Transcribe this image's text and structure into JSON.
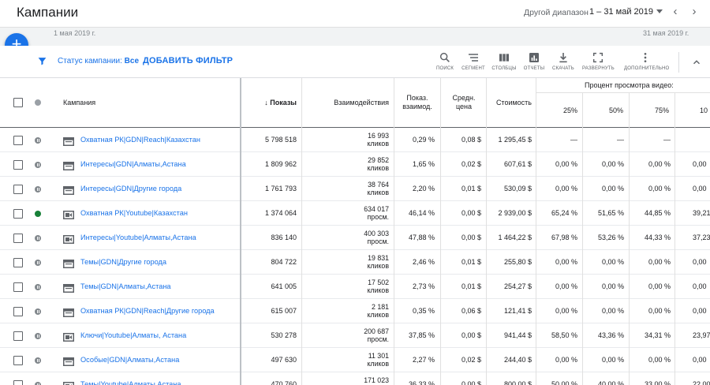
{
  "header": {
    "title": "Кампании",
    "range_label": "Другой диапазон",
    "range_value": "1 – 31 май 2019"
  },
  "strip": {
    "date_left": "1 мая 2019 г.",
    "date_right": "31 мая 2019 г."
  },
  "fab": {
    "label": "+"
  },
  "filter": {
    "status_prefix": "Статус кампании:",
    "status_value": "Все",
    "add_filter": "ДОБАВИТЬ ФИЛЬТР"
  },
  "tools": [
    {
      "label": "ПОИСК",
      "icon": "search-icon"
    },
    {
      "label": "СЕГМЕНТ",
      "icon": "segment-icon"
    },
    {
      "label": "СТОЛБЦЫ",
      "icon": "columns-icon"
    },
    {
      "label": "ОТЧЕТЫ",
      "icon": "reports-icon"
    },
    {
      "label": "СКАЧАТЬ",
      "icon": "download-icon"
    },
    {
      "label": "РАЗВЕРНУТЬ",
      "icon": "fullscreen-icon"
    },
    {
      "label": "ДОПОЛНИТЕЛЬНО",
      "icon": "more-vert-icon"
    }
  ],
  "columns": {
    "campaign": "Кампания",
    "impressions": "Показы",
    "interactions": "Взаимодействия",
    "interaction_rate": "Показ. взаимод.",
    "avg_cost": "Средн. цена",
    "cost": "Стоимость",
    "video_group": "Процент просмотра видео:",
    "p25": "25%",
    "p50": "50%",
    "p75": "75%",
    "p100": "10"
  },
  "rows": [
    {
      "status": "paused",
      "type": "display",
      "name": "Охватная РК|GDN|Reach|Казахстан",
      "impressions": "5 798 518",
      "int_num": "16 993",
      "int_unit": "кликов",
      "rate": "0,29 %",
      "avg": "0,08 $",
      "cost": "1 295,45 $",
      "p25": "—",
      "p50": "—",
      "p75": "—",
      "p100": ""
    },
    {
      "status": "paused",
      "type": "display",
      "name": "Интересы|GDN|Алматы,Астана",
      "impressions": "1 809 962",
      "int_num": "29 852",
      "int_unit": "кликов",
      "rate": "1,65 %",
      "avg": "0,02 $",
      "cost": "607,61 $",
      "p25": "0,00 %",
      "p50": "0,00 %",
      "p75": "0,00 %",
      "p100": "0,00"
    },
    {
      "status": "paused",
      "type": "display",
      "name": "Интересы|GDN|Другие города",
      "impressions": "1 761 793",
      "int_num": "38 764",
      "int_unit": "кликов",
      "rate": "2,20 %",
      "avg": "0,01 $",
      "cost": "530,09 $",
      "p25": "0,00 %",
      "p50": "0,00 %",
      "p75": "0,00 %",
      "p100": "0,00"
    },
    {
      "status": "active",
      "type": "video",
      "name": "Охватная РК|Youtube|Казахстан",
      "impressions": "1 374 064",
      "int_num": "634 017",
      "int_unit": "просм.",
      "rate": "46,14 %",
      "avg": "0,00 $",
      "cost": "2 939,00 $",
      "p25": "65,24 %",
      "p50": "51,65 %",
      "p75": "44,85 %",
      "p100": "39,21"
    },
    {
      "status": "paused",
      "type": "video",
      "name": "Интересы|Youtube|Алматы,Астана",
      "impressions": "836 140",
      "int_num": "400 303",
      "int_unit": "просм.",
      "rate": "47,88 %",
      "avg": "0,00 $",
      "cost": "1 464,22 $",
      "p25": "67,98 %",
      "p50": "53,26 %",
      "p75": "44,33 %",
      "p100": "37,23"
    },
    {
      "status": "paused",
      "type": "display",
      "name": "Темы|GDN|Другие города",
      "impressions": "804 722",
      "int_num": "19 831",
      "int_unit": "кликов",
      "rate": "2,46 %",
      "avg": "0,01 $",
      "cost": "255,80 $",
      "p25": "0,00 %",
      "p50": "0,00 %",
      "p75": "0,00 %",
      "p100": "0,00"
    },
    {
      "status": "paused",
      "type": "display",
      "name": "Темы|GDN|Алматы,Астана",
      "impressions": "641 005",
      "int_num": "17 502",
      "int_unit": "кликов",
      "rate": "2,73 %",
      "avg": "0,01 $",
      "cost": "254,27 $",
      "p25": "0,00 %",
      "p50": "0,00 %",
      "p75": "0,00 %",
      "p100": "0,00"
    },
    {
      "status": "paused",
      "type": "display",
      "name": "Охватная РК|GDN|Reach|Другие города",
      "impressions": "615 007",
      "int_num": "2 181",
      "int_unit": "кликов",
      "rate": "0,35 %",
      "avg": "0,06 $",
      "cost": "121,41 $",
      "p25": "0,00 %",
      "p50": "0,00 %",
      "p75": "0,00 %",
      "p100": "0,00"
    },
    {
      "status": "paused",
      "type": "video",
      "name": "Ключи|Youtube|Алматы, Астана",
      "impressions": "530 278",
      "int_num": "200 687",
      "int_unit": "просм.",
      "rate": "37,85 %",
      "avg": "0,00 $",
      "cost": "941,44 $",
      "p25": "58,50 %",
      "p50": "43,36 %",
      "p75": "34,31 %",
      "p100": "23,97"
    },
    {
      "status": "paused",
      "type": "display",
      "name": "Особые|GDN|Алматы,Астана",
      "impressions": "497 630",
      "int_num": "11 301",
      "int_unit": "кликов",
      "rate": "2,27 %",
      "avg": "0,02 $",
      "cost": "244,40 $",
      "p25": "0,00 %",
      "p50": "0,00 %",
      "p75": "0,00 %",
      "p100": "0,00"
    },
    {
      "status": "paused",
      "type": "video",
      "name": "Темы|Youtube|Алматы,Астана",
      "impressions": "470 760",
      "int_num": "171 023",
      "int_unit": "просм.",
      "rate": "36,33 %",
      "avg": "0,00 $",
      "cost": "800,00 $",
      "p25": "50,00 %",
      "p50": "40,00 %",
      "p75": "33,00 %",
      "p100": "22,00"
    }
  ]
}
